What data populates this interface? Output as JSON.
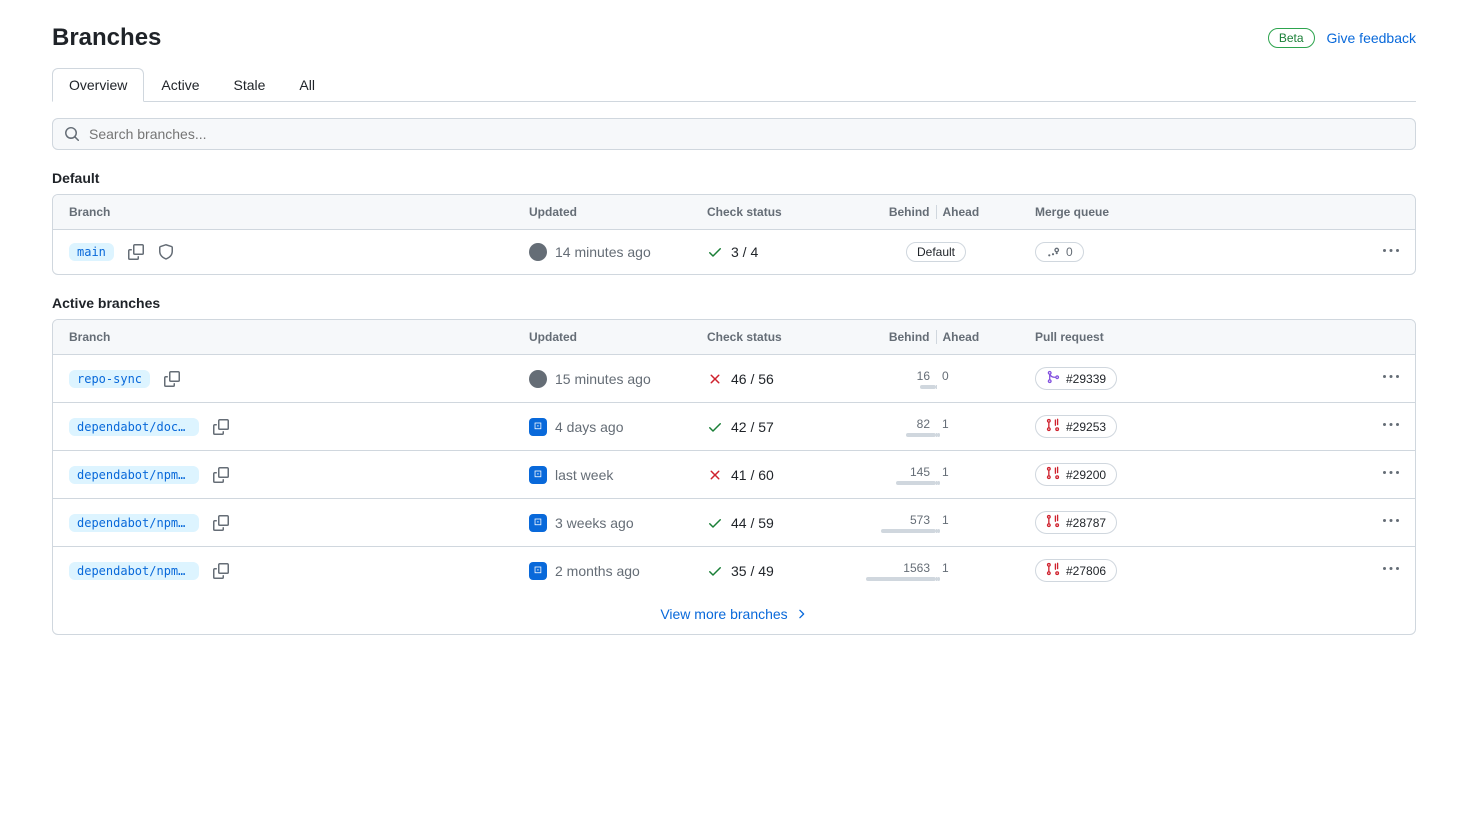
{
  "header": {
    "title": "Branches",
    "beta": "Beta",
    "feedback": "Give feedback"
  },
  "tabs": [
    "Overview",
    "Active",
    "Stale",
    "All"
  ],
  "search_placeholder": "Search branches...",
  "sections": {
    "default": {
      "title": "Default",
      "columns": {
        "branch": "Branch",
        "updated": "Updated",
        "check": "Check status",
        "behind": "Behind",
        "ahead": "Ahead",
        "last": "Merge queue"
      },
      "rows": [
        {
          "name": "main",
          "updated": "14 minutes ago",
          "check_ok": true,
          "check": "3 / 4",
          "default_label": "Default",
          "mq": "0",
          "avatar_type": "user"
        }
      ]
    },
    "active": {
      "title": "Active branches",
      "columns": {
        "branch": "Branch",
        "updated": "Updated",
        "check": "Check status",
        "behind": "Behind",
        "ahead": "Ahead",
        "last": "Pull request"
      },
      "rows": [
        {
          "name": "repo-sync",
          "updated": "15 minutes ago",
          "check_ok": false,
          "check": "46 / 56",
          "behind": "16",
          "ahead": "0",
          "pr": "#29339",
          "pr_type": "merged",
          "avatar_type": "user",
          "behind_w": 16,
          "ahead_w": 0
        },
        {
          "name": "dependabot/docker…",
          "updated": "4 days ago",
          "check_ok": true,
          "check": "42 / 57",
          "behind": "82",
          "ahead": "1",
          "pr": "#29253",
          "pr_type": "closed",
          "avatar_type": "bot",
          "behind_w": 30,
          "ahead_w": 3
        },
        {
          "name": "dependabot/npm_an…",
          "updated": "last week",
          "check_ok": false,
          "check": "41 / 60",
          "behind": "145",
          "ahead": "1",
          "pr": "#29200",
          "pr_type": "closed",
          "avatar_type": "bot",
          "behind_w": 40,
          "ahead_w": 3
        },
        {
          "name": "dependabot/npm_an…",
          "updated": "3 weeks ago",
          "check_ok": true,
          "check": "44 / 59",
          "behind": "573",
          "ahead": "1",
          "pr": "#28787",
          "pr_type": "closed",
          "avatar_type": "bot",
          "behind_w": 55,
          "ahead_w": 3
        },
        {
          "name": "dependabot/npm_an…",
          "updated": "2 months ago",
          "check_ok": true,
          "check": "35 / 49",
          "behind": "1563",
          "ahead": "1",
          "pr": "#27806",
          "pr_type": "closed",
          "avatar_type": "bot",
          "behind_w": 70,
          "ahead_w": 3
        }
      ],
      "view_more": "View more branches"
    }
  }
}
